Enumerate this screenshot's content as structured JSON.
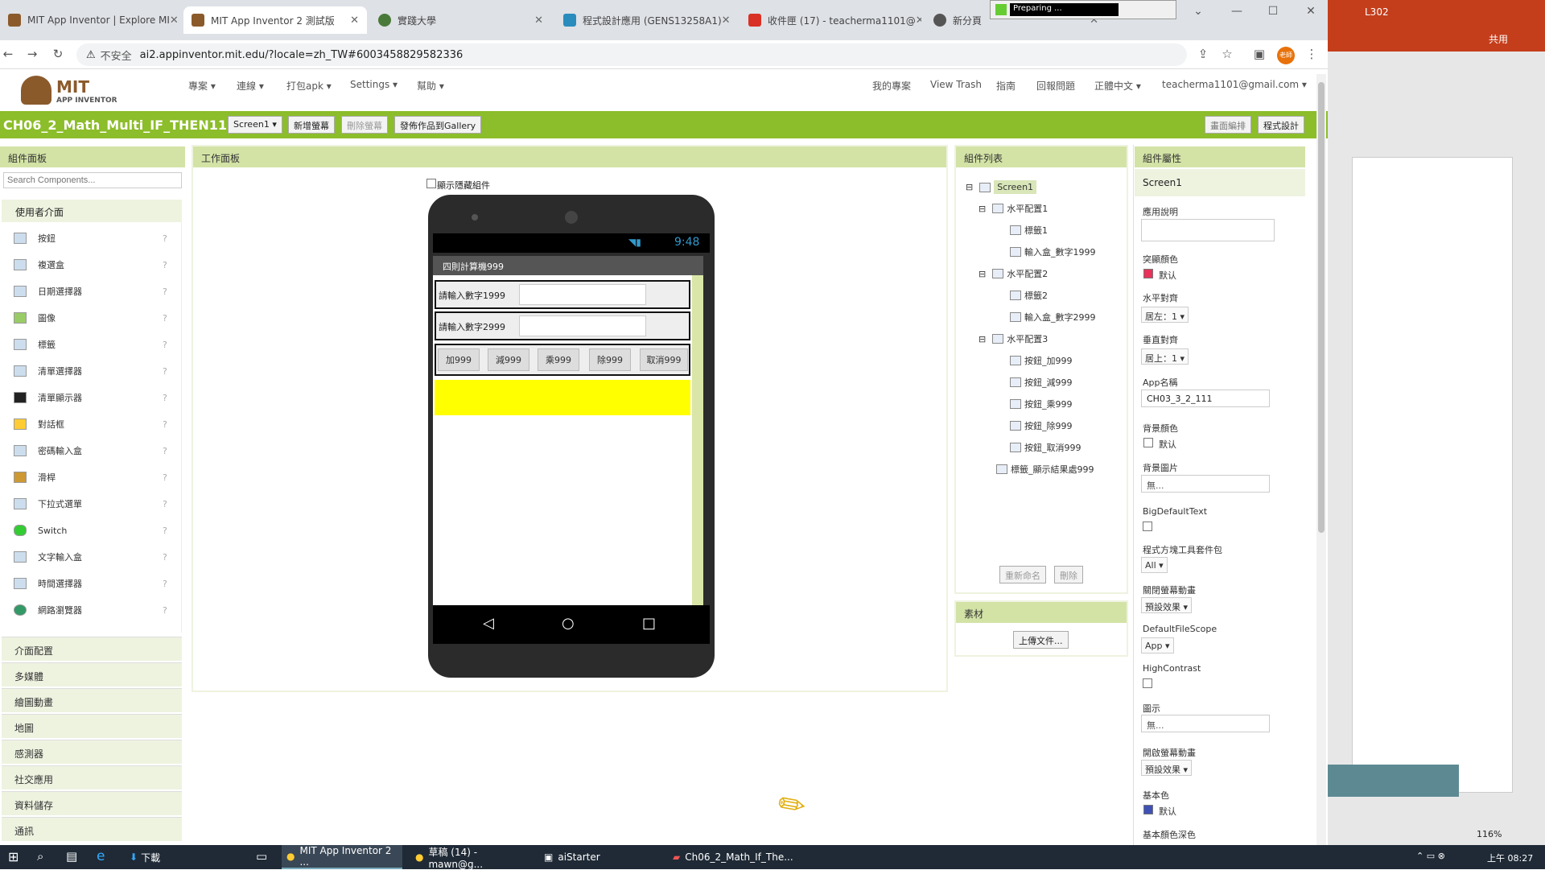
{
  "browser": {
    "tabs": [
      {
        "label": "MIT App Inventor | Explore MI",
        "color": "#8b5a2b"
      },
      {
        "label": "MIT App Inventor 2 測試版",
        "color": "#8b5a2b"
      },
      {
        "label": "實踐大學",
        "color": "#4a7a3a"
      },
      {
        "label": "程式設計應用 (GENS13258A1)",
        "color": "#2a8bbd"
      },
      {
        "label": "收件匣 (17) - teacherma1101@",
        "color": "#d93025"
      },
      {
        "label": "新分頁",
        "color": "#555"
      }
    ],
    "popup": "Preparing ...",
    "security": "不安全",
    "url": "ai2.appinventor.mit.edu/?locale=zh_TW#6003458829582336",
    "profile": "老師"
  },
  "appinventor": {
    "logo_top": "MIT",
    "logo_bottom": "APP INVENTOR",
    "menus": [
      "專案 ▾",
      "連線 ▾",
      "打包apk ▾",
      "Settings ▾",
      "幫助 ▾"
    ],
    "right_menus": [
      "我的專案",
      "View Trash",
      "指南",
      "回報問題",
      "正體中文 ▾",
      "teacherma1101@gmail.com ▾"
    ],
    "project_title": "CH06_2_Math_Multi_IF_THEN111",
    "toolbar": {
      "screen": "Screen1 ▾",
      "add_screen": "新增螢幕",
      "delete_screen": "刪除螢幕",
      "publish": "發佈作品到Gallery",
      "designer": "畫面編排",
      "blocks": "程式設計"
    }
  },
  "palette": {
    "header": "組件面板",
    "search_placeholder": "Search Components...",
    "section": "使用者介面",
    "items": [
      "按鈕",
      "複選盒",
      "日期選擇器",
      "圖像",
      "標籤",
      "清單選擇器",
      "清單顯示器",
      "對話框",
      "密碼輸入盒",
      "滑桿",
      "下拉式選單",
      "Switch",
      "文字輸入盒",
      "時間選擇器",
      "網路瀏覽器"
    ],
    "categories": [
      "介面配置",
      "多媒體",
      "繪圖動畫",
      "地圖",
      "感測器",
      "社交應用",
      "資料儲存",
      "通訊"
    ]
  },
  "viewer": {
    "header": "工作面板",
    "show_hidden": "顯示隱藏組件",
    "time": "9:48",
    "app_title": "四則計算機999",
    "label1": "請輸入數字1999",
    "label2": "請輸入數字2999",
    "buttons": [
      "加999",
      "減999",
      "乘999",
      "除999",
      "取消999"
    ]
  },
  "components": {
    "header": "組件列表",
    "tree": [
      "Screen1",
      "水平配置1",
      "標籤1",
      "輸入盒_數字1999",
      "水平配置2",
      "標籤2",
      "輸入盒_數字2999",
      "水平配置3",
      "按鈕_加999",
      "按鈕_減999",
      "按鈕_乘999",
      "按鈕_除999",
      "按鈕_取消999",
      "標籤_顯示結果處999"
    ],
    "rename": "重新命名",
    "delete": "刪除",
    "media_header": "素材",
    "upload": "上傳文件..."
  },
  "properties": {
    "header": "組件屬性",
    "component": "Screen1",
    "about_label": "應用說明",
    "accent_label": "突顯顏色",
    "accent_value": "默认",
    "accent_color": "#e8325a",
    "halign_label": "水平對齊",
    "halign_value": "居左：1 ▾",
    "valign_label": "垂直對齊",
    "valign_value": "居上：1 ▾",
    "appname_label": "App名稱",
    "appname_value": "CH03_3_2_111",
    "bgcolor_label": "背景顏色",
    "bgcolor_value": "默认",
    "bgimage_label": "背景圖片",
    "bgimage_value": "無...",
    "bigtext_label": "BigDefaultText",
    "blocks_label": "程式方塊工具套件包",
    "blocks_value": "All ▾",
    "closeanim_label": "關閉螢幕動畫",
    "closeanim_value": "預設效果 ▾",
    "filescope_label": "DefaultFileScope",
    "filescope_value": "App ▾",
    "contrast_label": "HighContrast",
    "icon_label": "圖示",
    "icon_value": "無...",
    "openanim_label": "開啟螢幕動畫",
    "openanim_value": "預設效果 ▾",
    "primary_label": "基本色",
    "primary_value": "默认",
    "primary_color": "#3f51b5",
    "primarydark_label": "基本顏色深色"
  },
  "right_app": {
    "room": "L302",
    "share": "共用",
    "zoom": "116%"
  },
  "taskbar": {
    "items": [
      "下載",
      "MIT App Inventor 2 ...",
      "草稿 (14) - mawn@g...",
      "aiStarter",
      "Ch06_2_Math_If_The..."
    ],
    "time": "上午 08:27"
  }
}
